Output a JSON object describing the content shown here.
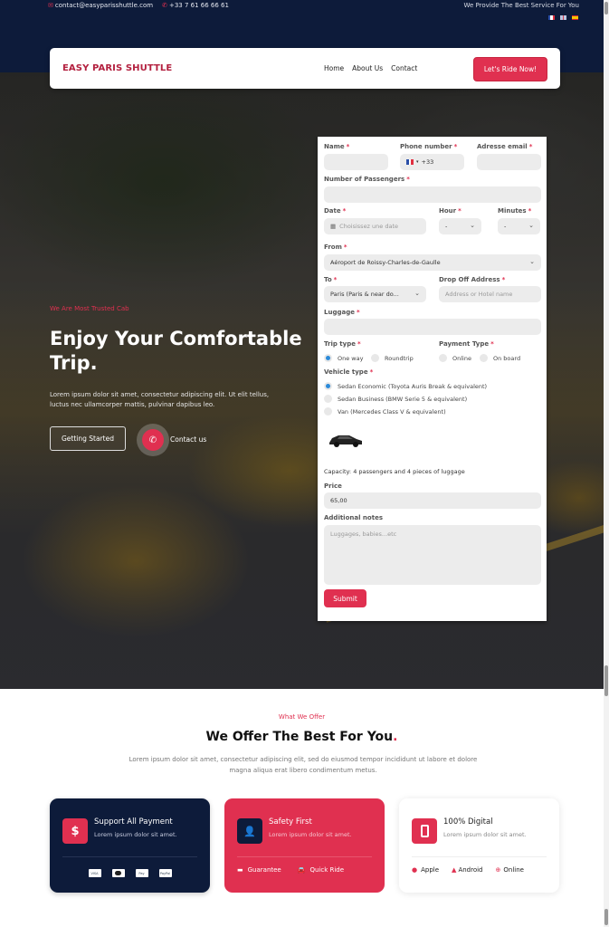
{
  "topbar": {
    "email": "contact@easyparisshuttle.com",
    "phone": "+33 7 61 66 66 61",
    "tagline": "We Provide The Best Service For You",
    "languages": [
      "fr",
      "en",
      "es"
    ]
  },
  "nav": {
    "brand": "EASY PARIS SHUTTLE",
    "links": [
      "Home",
      "About Us",
      "Contact"
    ],
    "cta": "Let's Ride Now!"
  },
  "hero": {
    "tag": "We Are Most Trusted Cab",
    "title": "Enjoy Your Comfortable Trip.",
    "description": "Lorem ipsum dolor sit amet, consectetur adipiscing elit. Ut elit tellus, luctus nec ullamcorper mattis, pulvinar dapibus leo.",
    "primary_button": "Getting Started",
    "contact_label": "Contact us"
  },
  "form": {
    "name_label": "Name",
    "phone_label": "Phone number",
    "phone_prefix": "+33",
    "email_label": "Adresse email",
    "passengers_label": "Number of Passengers",
    "date_label": "Date",
    "date_placeholder": "Choisissez une date",
    "hour_label": "Hour",
    "hour_value": "-",
    "minutes_label": "Minutes",
    "minutes_value": "-",
    "from_label": "From",
    "from_value": "Aéroport de Roissy-Charles-de-Gaulle",
    "to_label": "To",
    "to_value": "Paris (Paris & near do...",
    "dropoff_label": "Drop Off Address",
    "dropoff_placeholder": "Address or Hotel name",
    "luggage_label": "Luggage",
    "trip_type_label": "Trip type",
    "trip_types": [
      "One way",
      "Roundtrip"
    ],
    "trip_type_selected": "One way",
    "payment_type_label": "Payment Type",
    "payment_types": [
      "Online",
      "On board"
    ],
    "vehicle_type_label": "Vehicle type",
    "vehicles": [
      "Sedan Economic (Toyota Auris Break & equivalent)",
      "Sedan Business (BMW Serie 5 & equivalent)",
      "Van (Mercedes Class V & equivalent)"
    ],
    "vehicle_selected": "Sedan Economic (Toyota Auris Break & equivalent)",
    "capacity": "Capacity: 4 passengers and 4 pieces of luggage",
    "price_label": "Price",
    "price_value": "65,00",
    "notes_label": "Additional notes",
    "notes_placeholder": "Luggages, babies...etc",
    "submit": "Submit",
    "required_mark": "*"
  },
  "offer": {
    "tag": "What We Offer",
    "title": "We Offer The Best For You",
    "title_dot": ".",
    "description": "Lorem ipsum dolor sit amet, consectetur adipiscing elit, sed do eiusmod tempor incididunt ut labore et dolore magna aliqua erat libero condimentum metus.",
    "cards": [
      {
        "title": "Support All Payment",
        "desc": "Lorem ipsum dolor sit amet.",
        "icon": "$",
        "payments": [
          "VISA",
          "MC",
          "Pay",
          "PayPal"
        ]
      },
      {
        "title": "Safety First",
        "desc": "Lorem ipsum dolor sit amet.",
        "features": [
          "Guarantee",
          "Quick Ride"
        ]
      },
      {
        "title": "100% Digital",
        "desc": "Lorem ipsum dolor sit amet.",
        "features": [
          "Apple",
          "Android",
          "Online"
        ]
      }
    ]
  },
  "colors": {
    "accent": "#e03050",
    "navy": "#0d1b3a",
    "brand": "#b3203f"
  }
}
